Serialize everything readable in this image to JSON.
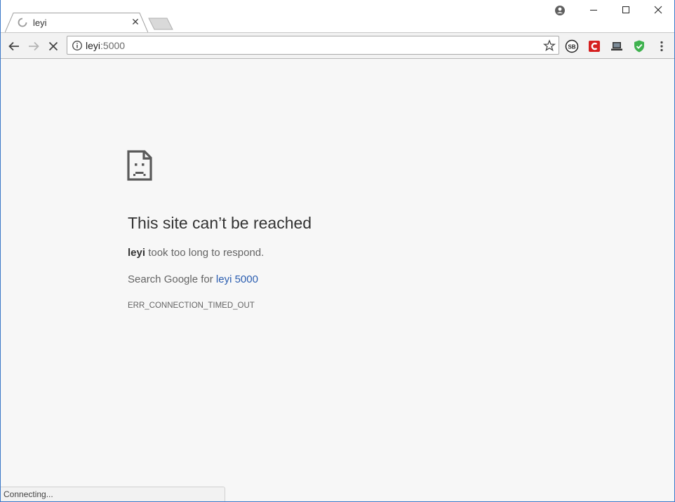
{
  "tab": {
    "title": "leyi",
    "close_glyph": "✕"
  },
  "omnibox": {
    "host": "leyi",
    "port": ":5000"
  },
  "error": {
    "title": "This site can’t be reached",
    "host_bold": "leyi",
    "message_rest": " took too long to respond.",
    "search_prefix": "Search Google for ",
    "search_link": "leyi 5000",
    "code": "ERR_CONNECTION_TIMED_OUT"
  },
  "status": {
    "text": "Connecting..."
  },
  "extensions": [
    "sb-extension-icon",
    "c-extension-icon",
    "laptop-extension-icon",
    "shield-extension-icon"
  ],
  "colors": {
    "link": "#2a5db0",
    "content_bg": "#f7f7f7",
    "window_border": "#3c78c8"
  }
}
